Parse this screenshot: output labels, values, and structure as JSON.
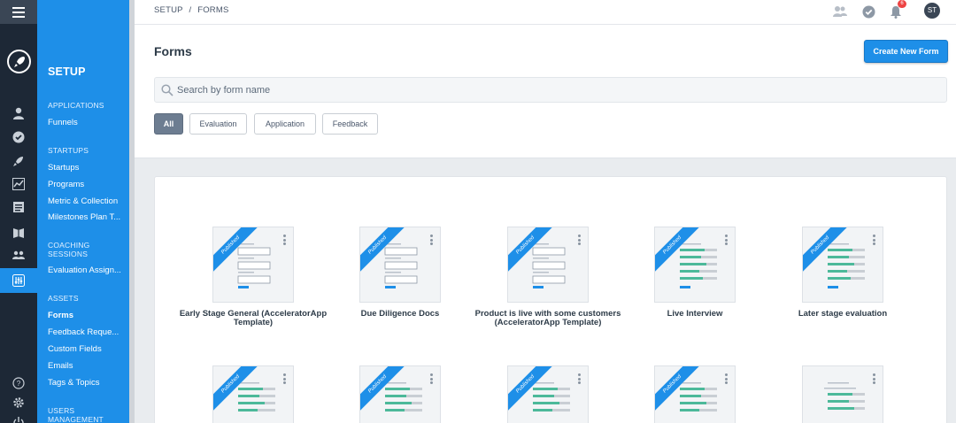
{
  "breadcrumb": {
    "part1": "SETUP",
    "sep": "/",
    "part2": "FORMS"
  },
  "topbar": {
    "notification_count": "6",
    "avatar_initials": "ST"
  },
  "sidebar": {
    "title": "SETUP",
    "sections": {
      "applications": "APPLICATIONS",
      "startups": "STARTUPS",
      "coaching": "COACHING SESSIONS",
      "assets": "ASSETS",
      "users": "USERS MANAGEMENT"
    },
    "items": {
      "funnels": "Funnels",
      "startups": "Startups",
      "programs": "Programs",
      "metric": "Metric & Collection",
      "milestones": "Milestones Plan T...",
      "evaluation": "Evaluation Assign...",
      "forms": "Forms",
      "feedback": "Feedback Reque...",
      "custom_fields": "Custom Fields",
      "emails": "Emails",
      "tags": "Tags & Topics"
    }
  },
  "page": {
    "title": "Forms",
    "create_button": "Create New Form",
    "search_placeholder": "Search by form name"
  },
  "filters": {
    "all": "All",
    "evaluation": "Evaluation",
    "application": "Application",
    "feedback": "Feedback"
  },
  "forms": {
    "badge": "Published",
    "row1": [
      "Early Stage General (AcceleratorApp Template)",
      "Due Diligence Docs",
      "Product is live with some customers (AcceleratorApp Template)",
      "Live Interview",
      "Later stage evaluation"
    ]
  },
  "colors": {
    "accent": "#1e8fe8",
    "rail": "#1d2836",
    "progress_green": "#4cb99a"
  }
}
